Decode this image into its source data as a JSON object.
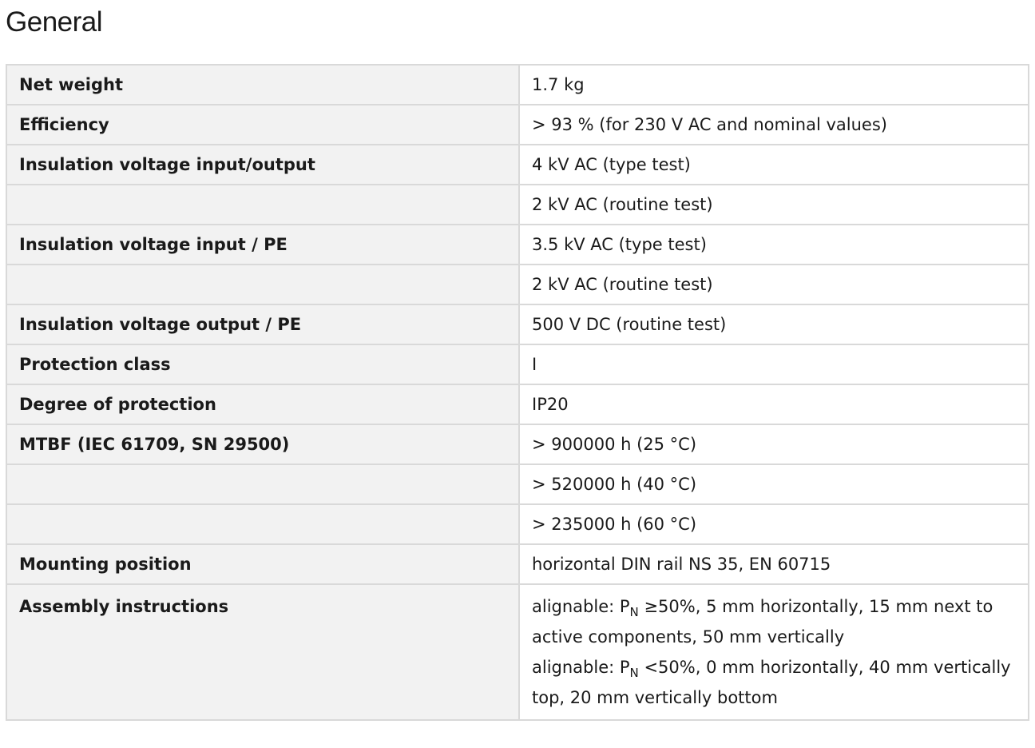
{
  "section_title": "General",
  "rows": [
    {
      "label": "Net weight",
      "value": "1.7 kg"
    },
    {
      "label": "Efficiency",
      "value": "> 93 % (for 230 V AC and nominal values)"
    },
    {
      "label": "Insulation voltage input/output",
      "value": "4 kV AC (type test)"
    },
    {
      "label": "",
      "value": "2 kV AC (routine test)"
    },
    {
      "label": "Insulation voltage input / PE",
      "value": "3.5 kV AC (type test)"
    },
    {
      "label": "",
      "value": "2 kV AC (routine test)"
    },
    {
      "label": "Insulation voltage output / PE",
      "value": "500 V DC (routine test)"
    },
    {
      "label": "Protection class",
      "value": "I"
    },
    {
      "label": "Degree of protection",
      "value": "IP20"
    },
    {
      "label": "MTBF (IEC 61709, SN 29500)",
      "value": "> 900000 h (25 °C)"
    },
    {
      "label": "",
      "value": "> 520000 h (40 °C)"
    },
    {
      "label": "",
      "value": "> 235000 h (60 °C)"
    },
    {
      "label": "Mounting position",
      "value": "horizontal DIN rail NS 35, EN 60715"
    }
  ],
  "assembly": {
    "label": "Assembly instructions",
    "line1": {
      "prefix": "alignable: P",
      "sub": "N",
      "suffix": " ≥50%, 5 mm horizontally, 15 mm next to active components, 50 mm vertically"
    },
    "line2": {
      "prefix": "alignable: P",
      "sub": "N",
      "suffix": " <50%, 0 mm horizontally, 40 mm vertically top, 20 mm vertically bottom"
    }
  }
}
